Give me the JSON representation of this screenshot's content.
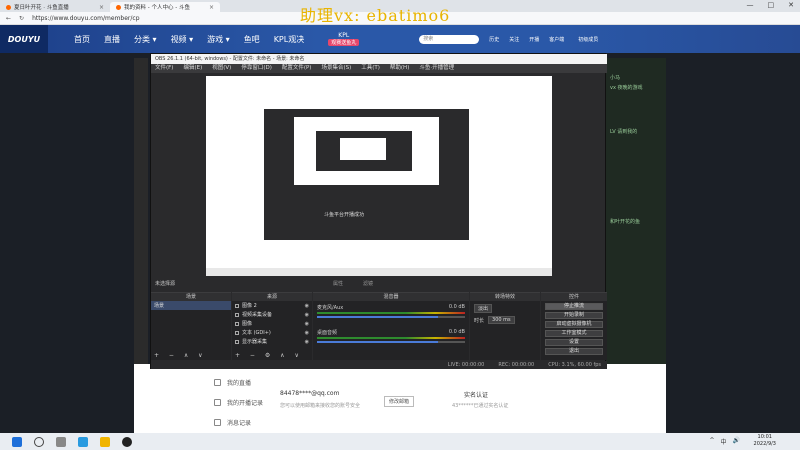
{
  "watermark": "助理vx: ebatimo6",
  "browser": {
    "tabs": [
      "夏日叶开花 · 斗鱼直播",
      "我的资料 - 个人中心 - 斗鱼"
    ],
    "url": "https://www.douyu.com/member/cp",
    "win_controls": [
      "—",
      "□",
      "✕"
    ]
  },
  "site": {
    "logo": "DOUYU",
    "nav": [
      "首页",
      "直播",
      "分类 ▾",
      "视频 ▾",
      "游戏 ▾",
      "鱼吧",
      "KPL观决"
    ],
    "kpl_title": "KPL",
    "kpl_badge": "观赛送鱼丸",
    "search_placeholder": "搜索",
    "header_icons": [
      "历史",
      "关注",
      "开播",
      "客户端"
    ],
    "user": "初级成员"
  },
  "obs": {
    "title": "OBS 26.1.1 (64-bit, windows) - 配置文件: 未命名 - 场景: 未命名",
    "menu": [
      "文件(F)",
      "编辑(E)",
      "视图(V)",
      "停靠窗口(D)",
      "配置文件(P)",
      "场景集合(S)",
      "工具(T)",
      "帮助(H)",
      "斗鱼·开播管理"
    ],
    "nested_text": "斗鱼平台开播成功",
    "scene_label": "未选择源",
    "preview_ctl": [
      "属性",
      "滤镜"
    ],
    "docks": {
      "scenes": {
        "title": "场景",
        "items": [
          "场景"
        ]
      },
      "sources": {
        "title": "来源",
        "items": [
          "图像 2",
          "视频采集设备",
          "图像",
          "文本 (GDI+)",
          "显示器采集"
        ]
      },
      "mixer": {
        "title": "混音器",
        "tracks": [
          {
            "name": "麦克风/Aux",
            "db": "0.0 dB",
            "level": 0.82
          },
          {
            "name": "桌面音频",
            "db": "0.0 dB",
            "level": 0.82
          }
        ]
      },
      "transitions": {
        "title": "转场特效",
        "effect": "淡出",
        "duration_label": "时长",
        "duration": "300 ms"
      },
      "controls": {
        "title": "控件",
        "buttons": [
          "停止推流",
          "开始录制",
          "启动虚拟摄像机",
          "工作室模式",
          "设置",
          "退出"
        ]
      }
    },
    "status": [
      "LIVE: 00:00:00",
      "REC: 00:00:00",
      "CPU: 3.1%, 60.00 fps"
    ]
  },
  "right_panel": [
    "小马",
    "vx 夜晚的游戏",
    "LV 请到我的",
    "和叶开花的鱼"
  ],
  "lower_page": {
    "items": [
      "我的直播",
      "我的开播记录",
      "消息记录"
    ],
    "email": "84478****@qq.com",
    "email_note": "您可以使用邮箱来接收您的账号安全",
    "email_btn": "修改邮箱",
    "verify_title": "实名认证",
    "verify_note": "43******已通过实名认证"
  },
  "taskbar": {
    "time": "10:01",
    "date": "2022/9/3",
    "tray": [
      "^",
      "中",
      "🔊"
    ]
  },
  "colors": {
    "site_blue": "#2a58a8",
    "watermark": "#e8b400",
    "obs_bg": "#2a2a2c"
  }
}
